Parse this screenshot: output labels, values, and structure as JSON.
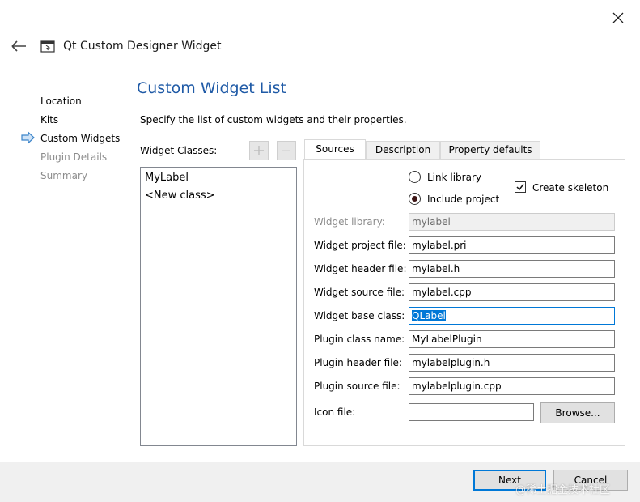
{
  "window": {
    "title": "Qt Custom Designer Widget"
  },
  "page": {
    "title": "Custom Widget List",
    "subtitle": "Specify the list of custom widgets and their properties."
  },
  "nav": {
    "items": [
      {
        "label": "Location",
        "state": "done"
      },
      {
        "label": "Kits",
        "state": "done"
      },
      {
        "label": "Custom Widgets",
        "state": "current"
      },
      {
        "label": "Plugin Details",
        "state": "pending"
      },
      {
        "label": "Summary",
        "state": "pending"
      }
    ]
  },
  "widget_classes": {
    "label": "Widget Classes:",
    "items": [
      "MyLabel",
      "<New class>"
    ]
  },
  "tabs": [
    "Sources",
    "Description",
    "Property defaults"
  ],
  "sources": {
    "link_library": "Link library",
    "include_project": "Include project",
    "create_skeleton": "Create skeleton",
    "fields": [
      {
        "label": "Widget library:",
        "value": "mylabel"
      },
      {
        "label": "Widget project file:",
        "value": "mylabel.pri"
      },
      {
        "label": "Widget header file:",
        "value": "mylabel.h"
      },
      {
        "label": "Widget source file:",
        "value": "mylabel.cpp"
      },
      {
        "label": "Widget base class:",
        "value": "QLabel"
      },
      {
        "label": "Plugin class name:",
        "value": "MyLabelPlugin"
      },
      {
        "label": "Plugin header file:",
        "value": "mylabelplugin.h"
      },
      {
        "label": "Plugin source file:",
        "value": "mylabelplugin.cpp"
      }
    ],
    "icon_label": "Icon file:",
    "browse": "Browse..."
  },
  "footer": {
    "next": "Next",
    "cancel": "Cancel"
  },
  "watermark": "@稀土掘金技术社区",
  "colors": {
    "accent": "#0078d7",
    "title": "#1f5aa6"
  },
  "icons": {
    "close": "close-icon",
    "back": "back-arrow-icon",
    "app": "qt-window-icon",
    "current_step": "current-step-arrow-icon",
    "add": "plus-icon",
    "remove": "minus-icon"
  }
}
